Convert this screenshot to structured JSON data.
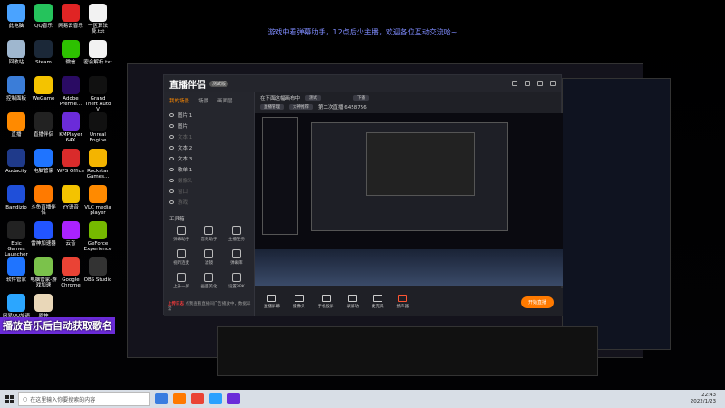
{
  "marquee": "游戏中看弹幕助手，12点后少主播，欢迎各位互动交流哈~",
  "desktop_icons": [
    {
      "label": "此电脑",
      "color": "#4aa3ff"
    },
    {
      "label": "QQ音乐",
      "color": "#25c35c"
    },
    {
      "label": "网易云音乐",
      "color": "#e02424"
    },
    {
      "label": "一区算法费.txt",
      "color": "#f2f2f2"
    },
    {
      "label": "回收站",
      "color": "#9fb7cf"
    },
    {
      "label": "Steam",
      "color": "#1b2838"
    },
    {
      "label": "微信",
      "color": "#2dc100"
    },
    {
      "label": "密会解析.txt",
      "color": "#f2f2f2"
    },
    {
      "label": "控制面板",
      "color": "#3b7dd8"
    },
    {
      "label": "WeGame",
      "color": "#f4c300"
    },
    {
      "label": "Adobe Premie...",
      "color": "#2a0b63"
    },
    {
      "label": "Grand Theft Auto V",
      "color": "#111"
    },
    {
      "label": "直播",
      "color": "#ff8a00"
    },
    {
      "label": "直播伴侣",
      "color": "#222"
    },
    {
      "label": "KMPlayer 64X",
      "color": "#6b2bd9"
    },
    {
      "label": "Unreal Engine",
      "color": "#111"
    },
    {
      "label": "Audacity",
      "color": "#1f3a8a"
    },
    {
      "label": "电脑管家",
      "color": "#1f74ff"
    },
    {
      "label": "WPS Office",
      "color": "#d92b2b"
    },
    {
      "label": "Rockstar Games...",
      "color": "#f4b400"
    },
    {
      "label": "Bandizip",
      "color": "#1f4fd9"
    },
    {
      "label": "斗鱼直播伴侣",
      "color": "#ff7a00"
    },
    {
      "label": "YY语音",
      "color": "#f4c300"
    },
    {
      "label": "VLC media player",
      "color": "#ff8a00"
    },
    {
      "label": "Epic Games Launcher",
      "color": "#222"
    },
    {
      "label": "雷神加速器",
      "color": "#2255ff"
    },
    {
      "label": "云音",
      "color": "#aa22ff"
    },
    {
      "label": "GeForce Experience",
      "color": "#76b900"
    },
    {
      "label": "软件管家",
      "color": "#1f74ff"
    },
    {
      "label": "电脑管家-游戏加速",
      "color": "#7bc24b"
    },
    {
      "label": "Google Chrome",
      "color": "#ea4335"
    },
    {
      "label": "OBS Studio",
      "color": "#333"
    },
    {
      "label": "网易UU加速",
      "color": "#2ba6ff"
    },
    {
      "label": "原神",
      "color": "#e9d7b8"
    }
  ],
  "app": {
    "logo": "直播伴侣",
    "version": "测试版",
    "tabs": [
      "我的场景",
      "场景",
      "画面层"
    ],
    "layers": [
      {
        "label": "图片 1",
        "dim": false
      },
      {
        "label": "图片",
        "dim": false
      },
      {
        "label": "文本 1",
        "dim": true
      },
      {
        "label": "文本 2",
        "dim": false
      },
      {
        "label": "文本 3",
        "dim": false
      },
      {
        "label": "歌单 1",
        "dim": false
      },
      {
        "label": "摄像头",
        "dim": true
      },
      {
        "label": "窗口",
        "dim": true
      },
      {
        "label": "游戏",
        "dim": true
      }
    ],
    "tools_title": "工具箱",
    "tools": [
      "弹幕助手",
      "音效助手",
      "主播任务",
      "视听连麦",
      "滤镜",
      "弹幕库",
      "上升一屏",
      "画面美化",
      "设置BPK"
    ],
    "footer_label": "上传日志",
    "footer_notice": "点我查看直播间广告播放中，数据异常",
    "room_title": "在下面这幅画布中",
    "btn_set": "测试",
    "btn_share": "下播",
    "btn_pk": "连线",
    "tags": [
      "直播管理",
      "大神推荐"
    ],
    "room_info": "第二次直播  6458756",
    "bottom_buttons": [
      "直播屏幕",
      "摄像头",
      "手机投屏",
      "录屏功",
      "麦克风",
      "扬声器"
    ],
    "go_live": "开始直播"
  },
  "caption": "播放音乐后自动获取歌名",
  "taskbar": {
    "search_placeholder": "在这里输入你要搜索的内容",
    "time": "22:43",
    "date": "2022/1/23"
  }
}
